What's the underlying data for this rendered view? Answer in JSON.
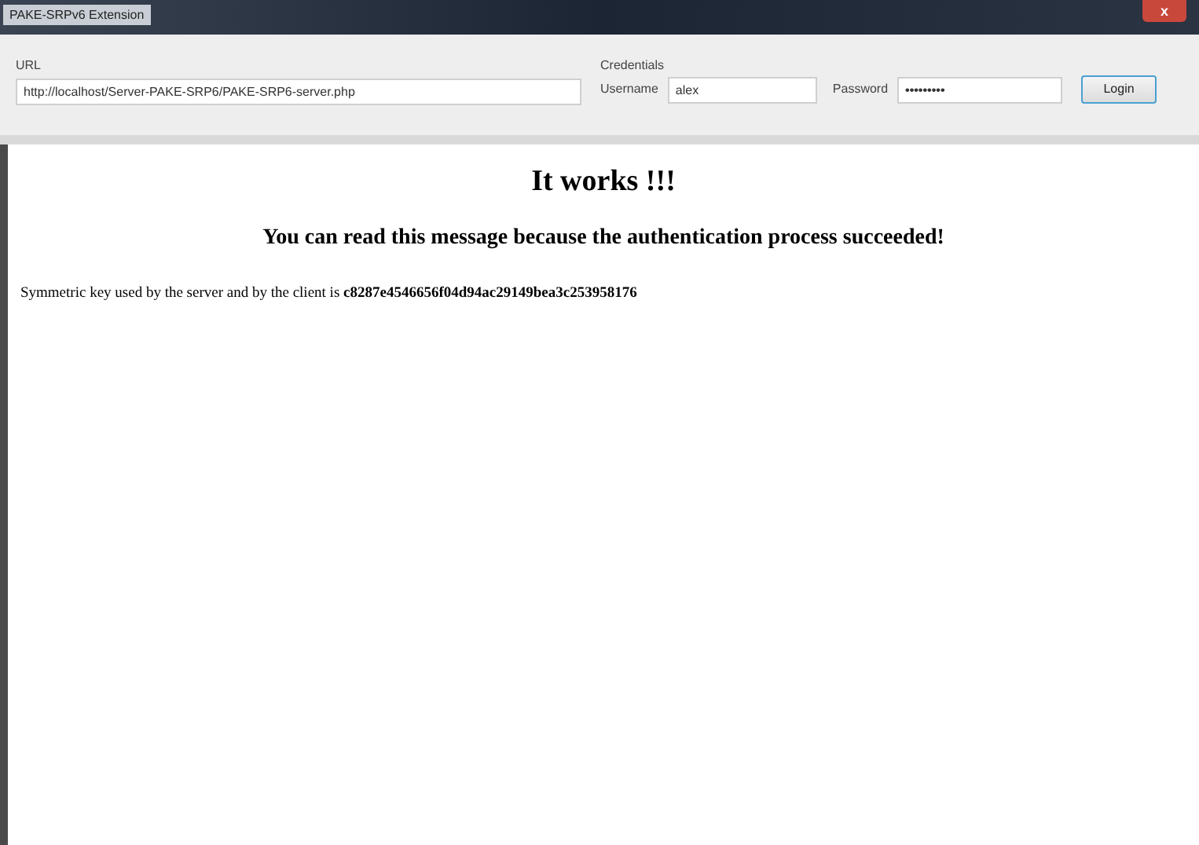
{
  "window": {
    "title": "PAKE-SRPv6 Extension",
    "close_label": "x"
  },
  "toolbar": {
    "url_label": "URL",
    "url_value": "http://localhost/Server-PAKE-SRP6/PAKE-SRP6-server.php",
    "credentials_label": "Credentials",
    "username_label": "Username",
    "username_value": "alex",
    "password_label": "Password",
    "password_value": "•••••••••",
    "login_button": "Login"
  },
  "content": {
    "heading": "It works !!!",
    "subheading": "You can read this message because the authentication process succeeded!",
    "key_text": "Symmetric key used by the server and by the client is **c8287e4546656f04d94ac29149bea3c253958176**"
  }
}
